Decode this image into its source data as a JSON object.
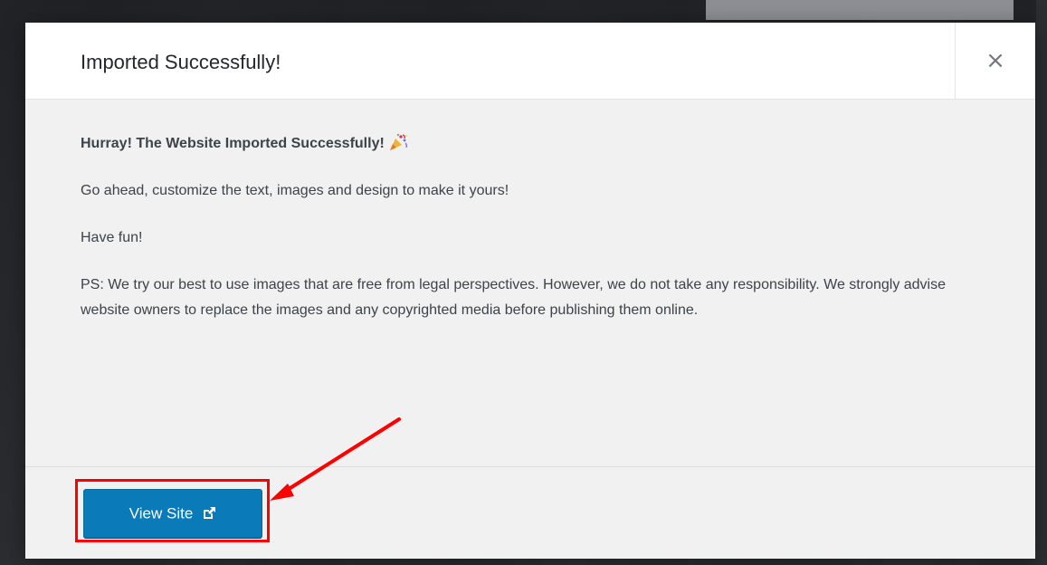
{
  "modal": {
    "title": "Imported Successfully!",
    "close_label": "×",
    "body": {
      "lead": "Hurray! The Website Imported Successfully!",
      "customize": "Go ahead, customize the text, images and design to make it yours!",
      "fun": "Have fun!",
      "ps": "PS: We try our best to use images that are free from legal perspectives. However, we do not take any responsibility. We strongly advise website owners to replace the images and any copyrighted media before publishing them online."
    },
    "footer": {
      "view_site_label": "View Site",
      "view_site_icon": "external-link-icon"
    }
  },
  "icons": {
    "lead_icon": "party-popper-icon"
  },
  "colors": {
    "primary_button": "#0a7bb8",
    "annotation": "#ff0000",
    "modal_background": "#f1f1f1"
  }
}
